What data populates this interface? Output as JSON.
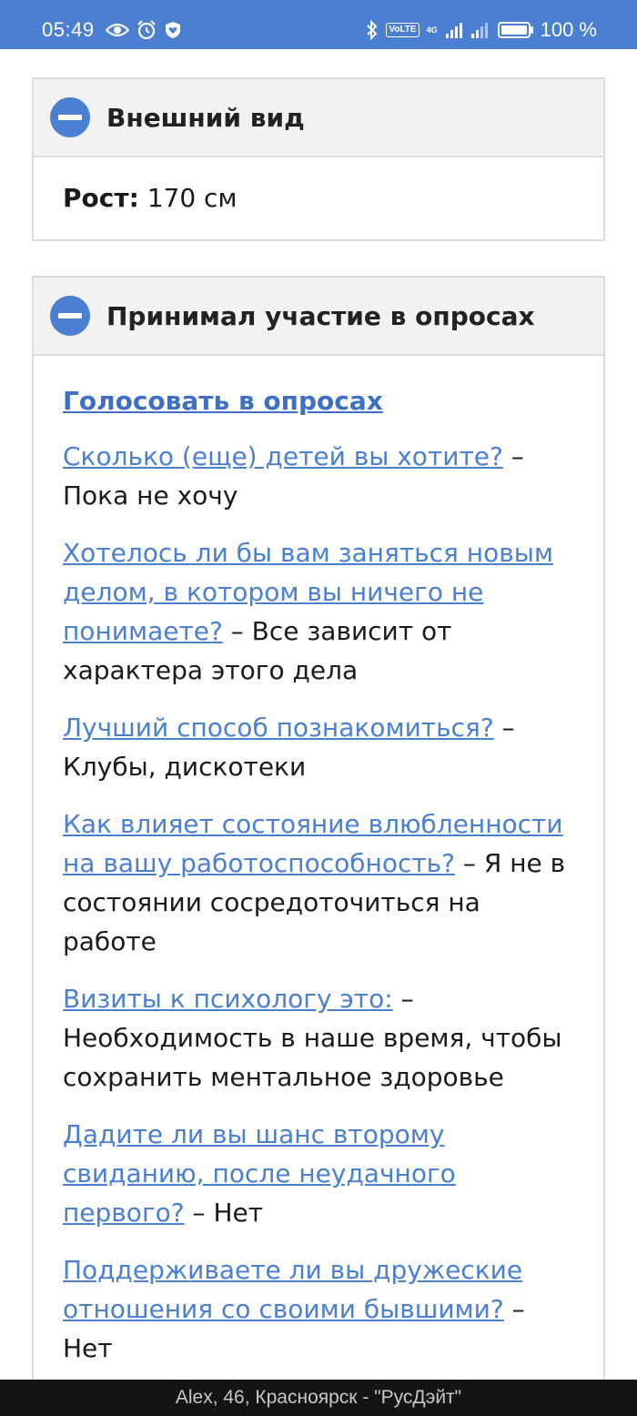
{
  "status_bar": {
    "time": "05:49",
    "volte": "VoLTE",
    "network_type": "4G",
    "battery": "100 %"
  },
  "appearance": {
    "title": "Внешний вид",
    "height_label": "Рост:",
    "height_value": "170 см"
  },
  "polls": {
    "title": "Принимал участие в опросах",
    "vote_link": "Голосовать в опросах",
    "items": [
      {
        "question": "Сколько (еще) детей вы хотите?",
        "answer": "Пока не хочу"
      },
      {
        "question": "Хотелось ли бы вам заняться новым делом, в котором вы ничего не понимаете?",
        "answer": "Все зависит от характера этого дела"
      },
      {
        "question": "Лучший способ познакомиться?",
        "answer": "Клубы, дискотеки"
      },
      {
        "question": "Как влияет состояние влюбленности на вашу работоспособность?",
        "answer": "Я не в состоянии сосредоточиться на работе"
      },
      {
        "question": "Визиты к психологу это:",
        "answer": "Необходимость в наше время, чтобы сохранить ментальное здоровье"
      },
      {
        "question": "Дадите ли вы шанс второму свиданию, после неудачного первого?",
        "answer": "Нет"
      },
      {
        "question": "Поддерживаете ли вы дружеские отношения со своими бывшими?",
        "answer": "Нет"
      }
    ]
  },
  "bottom_bar": {
    "text": "Alex, 46, Красноярск - \"РусДэйт\""
  },
  "colors": {
    "accent": "#4a7fd1",
    "panel_header_bg": "#f2f2f2",
    "border": "#dcdcdc"
  }
}
